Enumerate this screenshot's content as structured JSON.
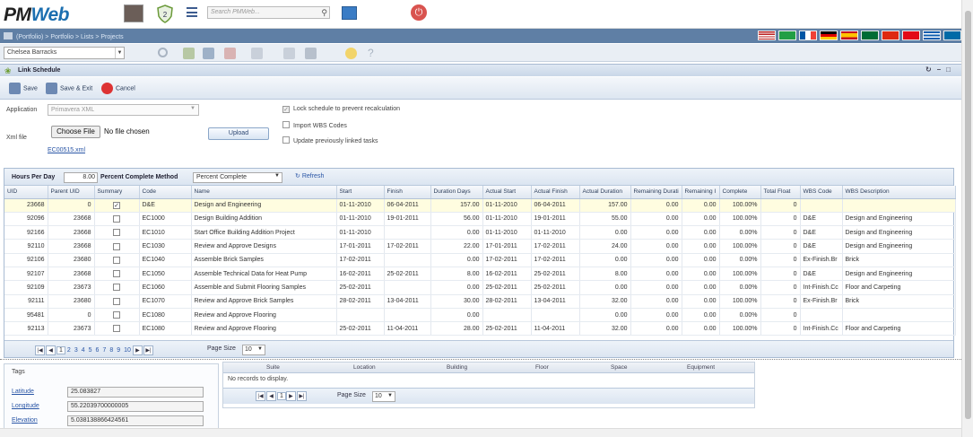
{
  "header": {
    "logo_main": "PM",
    "logo_accent": "Web",
    "notification_count": "2",
    "search_placeholder": "Search PMWeb..."
  },
  "breadcrumb": "(Portfolio) > Portfolio > Lists > Projects",
  "flags": [
    "us",
    "br",
    "fr",
    "de",
    "es",
    "sa",
    "cn",
    "tr",
    "gr",
    "se"
  ],
  "project_select": "Chelsea Barracks",
  "panel": {
    "title": "Link Schedule"
  },
  "actions": {
    "save": "Save",
    "save_exit": "Save & Exit",
    "cancel": "Cancel"
  },
  "form": {
    "application_label": "Application",
    "application_value": "Primavera XML",
    "xml_label": "Xml file",
    "choose_file": "Choose File",
    "no_file": "No file chosen",
    "upload": "Upload",
    "file_link": "EC00515.xml",
    "lock_label": "Lock schedule to prevent recalculation",
    "import_wbs_label": "Import WBS Codes",
    "update_label": "Update previously linked tasks"
  },
  "grid_toolbar": {
    "hours_label": "Hours Per Day",
    "hours_value": "8.00",
    "pcm_label": "Percent Complete Method",
    "pcm_value": "Percent Complete",
    "refresh": "Refresh"
  },
  "columns": [
    "UID",
    "Parent UID",
    "Summary",
    "Code",
    "Name",
    "Start",
    "Finish",
    "Duration Days",
    "Actual Start",
    "Actual Finish",
    "Actual Duration",
    "Remaining Durati",
    "Remaining I",
    "Complete",
    "Total Float",
    "WBS Code",
    "WBS Description"
  ],
  "rows": [
    {
      "uid": "23668",
      "parent": "0",
      "summary": true,
      "code": "D&E",
      "name": "Design and Engineering",
      "start": "01-11-2010",
      "finish": "06-04-2011",
      "dur": "157.00",
      "astart": "01-11-2010",
      "afinish": "06-04-2011",
      "adur": "157.00",
      "rdur": "0.00",
      "rem": "0.00",
      "complete": "100.00%",
      "float": "0",
      "wbs": "",
      "wbsdesc": ""
    },
    {
      "uid": "92096",
      "parent": "23668",
      "summary": false,
      "code": "EC1000",
      "name": "Design Building Addition",
      "start": "01-11-2010",
      "finish": "19-01-2011",
      "dur": "56.00",
      "astart": "01-11-2010",
      "afinish": "19-01-2011",
      "adur": "55.00",
      "rdur": "0.00",
      "rem": "0.00",
      "complete": "100.00%",
      "float": "0",
      "wbs": "D&E",
      "wbsdesc": "Design and Engineering"
    },
    {
      "uid": "92166",
      "parent": "23668",
      "summary": false,
      "code": "EC1010",
      "name": "Start Office Building Addition Project",
      "start": "01-11-2010",
      "finish": "",
      "dur": "0.00",
      "astart": "01-11-2010",
      "afinish": "01-11-2010",
      "adur": "0.00",
      "rdur": "0.00",
      "rem": "0.00",
      "complete": "0.00%",
      "float": "0",
      "wbs": "D&E",
      "wbsdesc": "Design and Engineering"
    },
    {
      "uid": "92110",
      "parent": "23668",
      "summary": false,
      "code": "EC1030",
      "name": "Review and Approve Designs",
      "start": "17-01-2011",
      "finish": "17-02-2011",
      "dur": "22.00",
      "astart": "17-01-2011",
      "afinish": "17-02-2011",
      "adur": "24.00",
      "rdur": "0.00",
      "rem": "0.00",
      "complete": "100.00%",
      "float": "0",
      "wbs": "D&E",
      "wbsdesc": "Design and Engineering"
    },
    {
      "uid": "92106",
      "parent": "23680",
      "summary": false,
      "code": "EC1040",
      "name": "Assemble Brick Samples",
      "start": "17-02-2011",
      "finish": "",
      "dur": "0.00",
      "astart": "17-02-2011",
      "afinish": "17-02-2011",
      "adur": "0.00",
      "rdur": "0.00",
      "rem": "0.00",
      "complete": "0.00%",
      "float": "0",
      "wbs": "Ex-Finish.Br",
      "wbsdesc": "Brick"
    },
    {
      "uid": "92107",
      "parent": "23668",
      "summary": false,
      "code": "EC1050",
      "name": "Assemble Technical Data for Heat Pump",
      "start": "16-02-2011",
      "finish": "25-02-2011",
      "dur": "8.00",
      "astart": "16-02-2011",
      "afinish": "25-02-2011",
      "adur": "8.00",
      "rdur": "0.00",
      "rem": "0.00",
      "complete": "100.00%",
      "float": "0",
      "wbs": "D&E",
      "wbsdesc": "Design and Engineering"
    },
    {
      "uid": "92109",
      "parent": "23673",
      "summary": false,
      "code": "EC1060",
      "name": "Assemble and Submit Flooring Samples",
      "start": "25-02-2011",
      "finish": "",
      "dur": "0.00",
      "astart": "25-02-2011",
      "afinish": "25-02-2011",
      "adur": "0.00",
      "rdur": "0.00",
      "rem": "0.00",
      "complete": "0.00%",
      "float": "0",
      "wbs": "Int-Finish.Cc",
      "wbsdesc": "Floor and Carpeting"
    },
    {
      "uid": "92111",
      "parent": "23680",
      "summary": false,
      "code": "EC1070",
      "name": "Review and Approve Brick Samples",
      "start": "28-02-2011",
      "finish": "13-04-2011",
      "dur": "30.00",
      "astart": "28-02-2011",
      "afinish": "13-04-2011",
      "adur": "32.00",
      "rdur": "0.00",
      "rem": "0.00",
      "complete": "100.00%",
      "float": "0",
      "wbs": "Ex-Finish.Br",
      "wbsdesc": "Brick"
    },
    {
      "uid": "95481",
      "parent": "0",
      "summary": false,
      "code": "EC1080",
      "name": "Review and Approve Flooring",
      "start": "",
      "finish": "",
      "dur": "0.00",
      "astart": "",
      "afinish": "",
      "adur": "0.00",
      "rdur": "0.00",
      "rem": "0.00",
      "complete": "0.00%",
      "float": "0",
      "wbs": "",
      "wbsdesc": ""
    },
    {
      "uid": "92113",
      "parent": "23673",
      "summary": false,
      "code": "EC1080",
      "name": "Review and Approve Flooring",
      "start": "25-02-2011",
      "finish": "11-04-2011",
      "dur": "28.00",
      "astart": "25-02-2011",
      "afinish": "11-04-2011",
      "adur": "32.00",
      "rdur": "0.00",
      "rem": "0.00",
      "complete": "100.00%",
      "float": "0",
      "wbs": "Int-Finish.Cc",
      "wbsdesc": "Floor and Carpeting"
    }
  ],
  "pager": {
    "pages": [
      "1",
      "2",
      "3",
      "4",
      "5",
      "6",
      "7",
      "8",
      "9",
      "10"
    ],
    "page_size_label": "Page Size",
    "page_size": "10"
  },
  "tags": {
    "title": "Tags",
    "latitude_label": "Latitude",
    "latitude": "25.083827",
    "longitude_label": "Longitude",
    "longitude": "55.22039700000005",
    "elevation_label": "Elevation",
    "elevation": "5.038138866424561"
  },
  "locations": {
    "columns": [
      "Suite",
      "Location",
      "Building",
      "Floor",
      "Space",
      "Equipment"
    ],
    "empty": "No records to display.",
    "page": "1",
    "page_size_label": "Page Size",
    "page_size": "10"
  }
}
